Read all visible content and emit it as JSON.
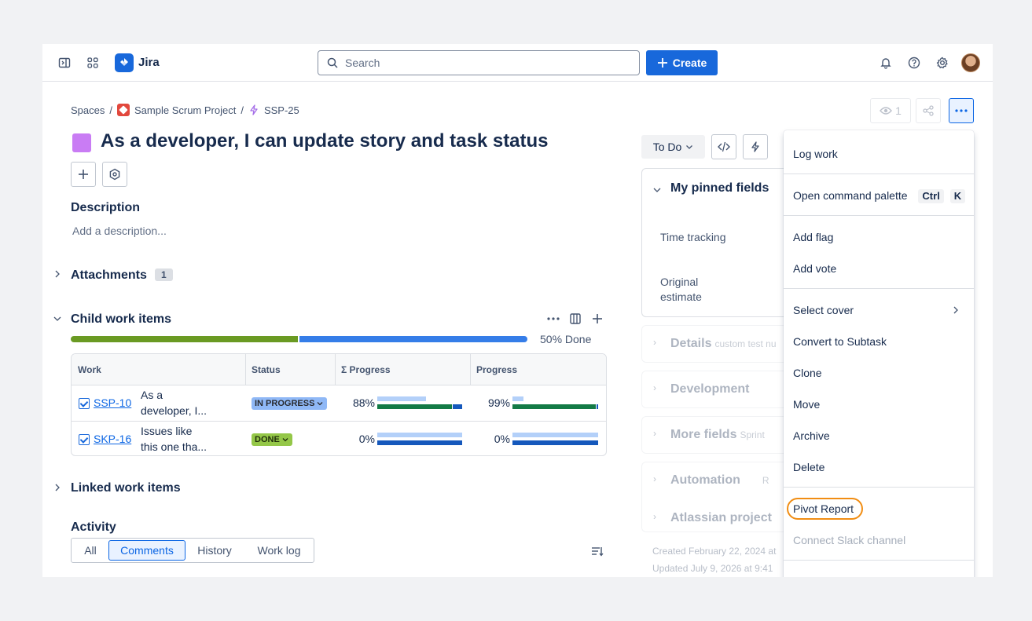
{
  "app": {
    "name": "Jira"
  },
  "search": {
    "placeholder": "Search"
  },
  "topbar": {
    "create_label": "Create"
  },
  "breadcrumb": {
    "spaces": "Spaces",
    "sep1": "/",
    "project": "Sample Scrum Project",
    "sep2": "/",
    "issue_key": "SSP-25"
  },
  "issue": {
    "title": "As a developer, I can update story and task status",
    "watchers": "1",
    "status": "To Do"
  },
  "description": {
    "heading": "Description",
    "placeholder": "Add a description..."
  },
  "attachments": {
    "heading": "Attachments",
    "count": "1"
  },
  "child_items": {
    "heading": "Child work items",
    "done_label": "50% Done",
    "done_fraction": 0.5,
    "columns": [
      "Work",
      "Status",
      "Σ Progress",
      "Progress"
    ],
    "rows": [
      {
        "key": "SSP-10",
        "summary_l1": "As a",
        "summary_l2": "developer, I...",
        "status": "IN PROGRESS",
        "sum_progress": "88%",
        "sum_fraction": 0.88,
        "progress": "99%",
        "progress_fraction": 0.99
      },
      {
        "key": "SKP-16",
        "summary_l1": "Issues like",
        "summary_l2": "this one tha...",
        "status": "DONE",
        "sum_progress": "0%",
        "sum_fraction": 0,
        "progress": "0%",
        "progress_fraction": 0
      }
    ]
  },
  "linked": {
    "heading": "Linked work items"
  },
  "activity": {
    "heading": "Activity",
    "tabs": [
      "All",
      "Comments",
      "History",
      "Work log"
    ],
    "active_tab": "Comments"
  },
  "pinned": {
    "heading": "My pinned fields",
    "field1": "Time tracking",
    "field2_l1": "Original",
    "field2_l2": "estimate"
  },
  "sections": [
    {
      "label": "Details",
      "sub": "custom test nu"
    },
    {
      "label": "Development",
      "sub": ""
    },
    {
      "label": "More fields",
      "sub": "Sprint"
    },
    {
      "label": "Automation",
      "sub": "R"
    },
    {
      "label": "Atlassian project",
      "sub": ""
    }
  ],
  "meta": {
    "created": "Created February 22, 2024 at",
    "updated": "Updated July 9, 2026 at 9:41"
  },
  "menu": {
    "log_work": "Log work",
    "command_palette": "Open command palette",
    "kbd1": "Ctrl",
    "kbd2": "K",
    "add_flag": "Add flag",
    "add_vote": "Add vote",
    "select_cover": "Select cover",
    "convert": "Convert to Subtask",
    "clone": "Clone",
    "move": "Move",
    "archive": "Archive",
    "delete": "Delete",
    "pivot": "Pivot Report",
    "slack": "Connect Slack channel"
  },
  "colors": {
    "accent": "#1868db",
    "story": "#c97cf4",
    "progress_green": "#6a9a23",
    "progress_blue": "#357de8",
    "highlight": "#f18d13"
  }
}
